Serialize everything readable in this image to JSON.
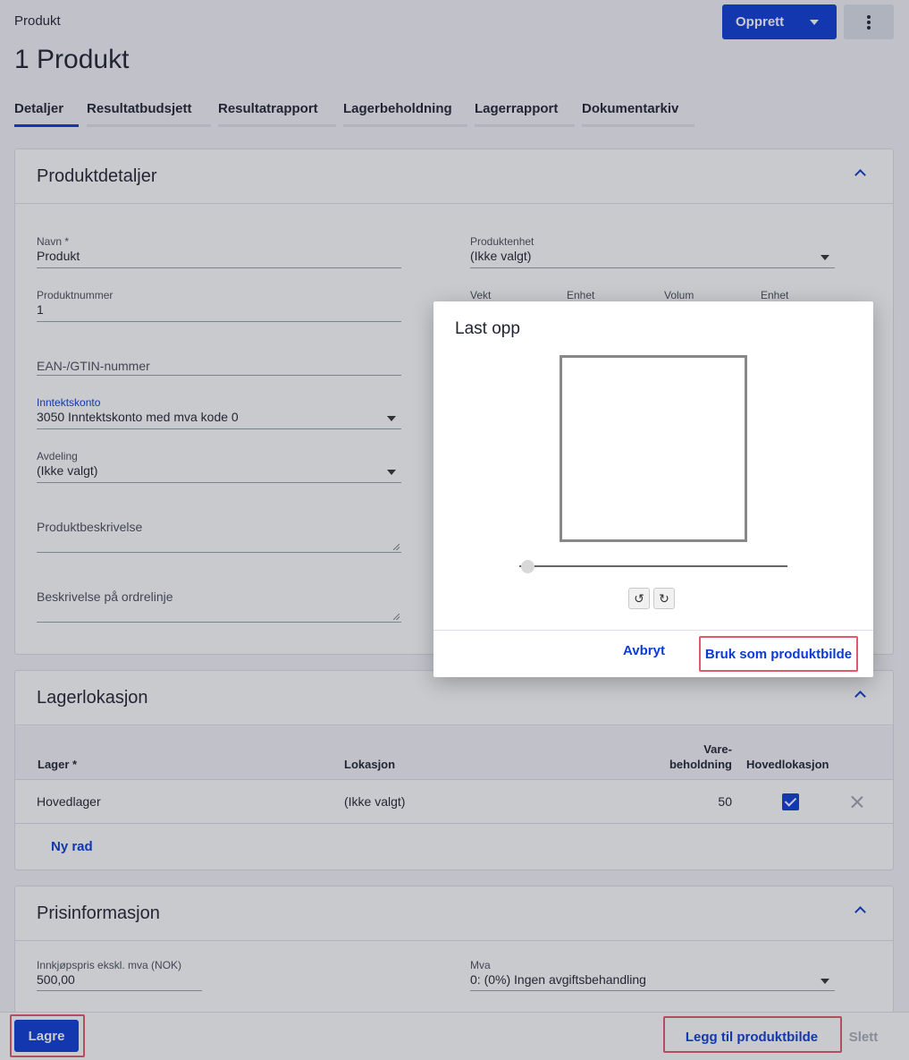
{
  "header": {
    "breadcrumb": "Produkt",
    "title": "1 Produkt",
    "create_label": "Opprett",
    "more_icon": "more-vertical-icon"
  },
  "tabs": [
    {
      "label": "Detaljer",
      "active": true
    },
    {
      "label": "Resultatbudsjett",
      "active": false
    },
    {
      "label": "Resultatrapport",
      "active": false
    },
    {
      "label": "Lagerbeholdning",
      "active": false
    },
    {
      "label": "Lagerrapport",
      "active": false
    },
    {
      "label": "Dokumentarkiv",
      "active": false
    }
  ],
  "details": {
    "title": "Produktdetaljer",
    "name_label": "Navn *",
    "name_value": "Produkt",
    "product_number_label": "Produktnummer",
    "product_number_value": "1",
    "ean_placeholder": "EAN-/GTIN-nummer",
    "income_account_label": "Inntektskonto",
    "income_account_value": "3050 Inntektskonto med mva kode 0",
    "department_label": "Avdeling",
    "department_value": "(Ikke valgt)",
    "description_placeholder": "Produktbeskrivelse",
    "order_line_placeholder": "Beskrivelse på ordrelinje",
    "unit_label": "Produktenhet",
    "unit_value": "(Ikke valgt)",
    "weight_label": "Vekt",
    "weight_unit_label": "Enhet",
    "volume_label": "Volum",
    "volume_unit_label": "Enhet"
  },
  "location": {
    "title": "Lagerlokasjon",
    "columns": {
      "warehouse": "Lager *",
      "location": "Lokasjon",
      "stock_line1": "Vare-",
      "stock_line2": "beholdning",
      "main_location": "Hovedlokasjon"
    },
    "rows": [
      {
        "warehouse": "Hovedlager",
        "location": "(Ikke valgt)",
        "stock": "50",
        "main": true
      }
    ],
    "new_row_label": "Ny rad"
  },
  "price": {
    "title": "Prisinformasjon",
    "purchase_label": "Innkjøpspris ekskl. mva (NOK)",
    "purchase_value": "500,00",
    "vat_label": "Mva",
    "vat_value": "0: (0%) Ingen avgiftsbehandling"
  },
  "bottom": {
    "save_label": "Lagre",
    "add_image_label": "Legg til produktbilde",
    "delete_label": "Slett"
  },
  "modal": {
    "title": "Last opp",
    "rotate_left_symbol": "↺",
    "rotate_right_symbol": "↻",
    "zoom_level": 0,
    "cancel_label": "Avbryt",
    "confirm_label": "Bruk som produktbilde"
  },
  "colors": {
    "accent": "#0b3bd4",
    "highlight": "#e05a6b"
  }
}
